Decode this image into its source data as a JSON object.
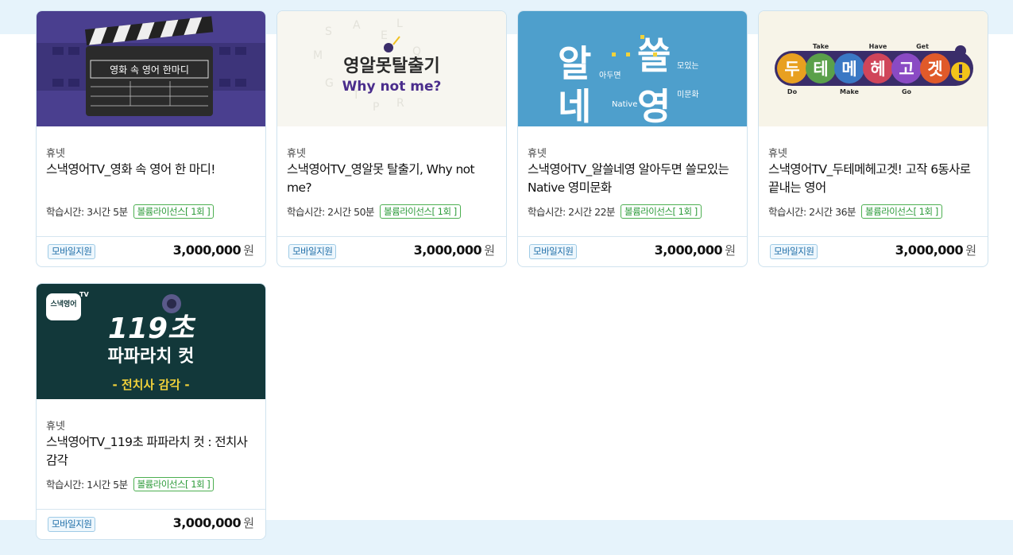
{
  "products": [
    {
      "provider": "휴넷",
      "title": "스낵영어TV_영화 속 영어 한 마디!",
      "study_time": "학습시간: 3시간 5분",
      "license": "볼륨라이선스[ 1회 ]",
      "mobile": "모바일지원",
      "price": "3,000,000",
      "currency": "원",
      "thumb_text": "영화 속 영어 한마디"
    },
    {
      "provider": "휴넷",
      "title": "스낵영어TV_영알못 탈출기, Why not me?",
      "study_time": "학습시간: 2시간 50분",
      "license": "볼륨라이선스[ 1회 ]",
      "mobile": "모바일지원",
      "price": "3,000,000",
      "currency": "원",
      "thumb_text": "영알못탈출기",
      "thumb_sub": "Why not me?"
    },
    {
      "provider": "휴넷",
      "title": "스낵영어TV_알쓸네영 알아두면 쓸모있는 Native 영미문화",
      "study_time": "학습시간: 2시간 22분",
      "license": "볼륨라이선스[ 1회 ]",
      "mobile": "모바일지원",
      "price": "3,000,000",
      "currency": "원",
      "thumb_chars": [
        "알",
        "쓸",
        "네",
        "영"
      ],
      "thumb_words": [
        "아두면",
        "모있는",
        "Native",
        "미문화"
      ]
    },
    {
      "provider": "휴넷",
      "title": "스낵영어TV_두테메헤고겟! 고작 6동사로 끝내는 영어",
      "study_time": "학습시간: 2시간 36분",
      "license": "볼륨라이선스[ 1회 ]",
      "mobile": "모바일지원",
      "price": "3,000,000",
      "currency": "원",
      "thumb_chars": [
        "두",
        "테",
        "메",
        "헤",
        "고",
        "겟"
      ],
      "thumb_words": [
        "Take",
        "Have",
        "Get",
        "Do",
        "Make",
        "Go"
      ]
    },
    {
      "provider": "휴넷",
      "title": "스낵영어TV_119초 파파라치 컷 : 전치사 감각",
      "study_time": "학습시간: 1시간 5분",
      "license": "볼륨라이선스[ 1회 ]",
      "mobile": "모바일지원",
      "price": "3,000,000",
      "currency": "원",
      "thumb_logo": "스낵영어",
      "thumb_tv": "TV",
      "thumb_big": "119초",
      "thumb_mid": "파파라치 컷",
      "thumb_bottom": "- 전치사 감각 -"
    }
  ],
  "colors": {
    "band": "#e6f3fb",
    "license_green": "#2e9b3b",
    "mobile_blue": "#1f6ea8"
  }
}
